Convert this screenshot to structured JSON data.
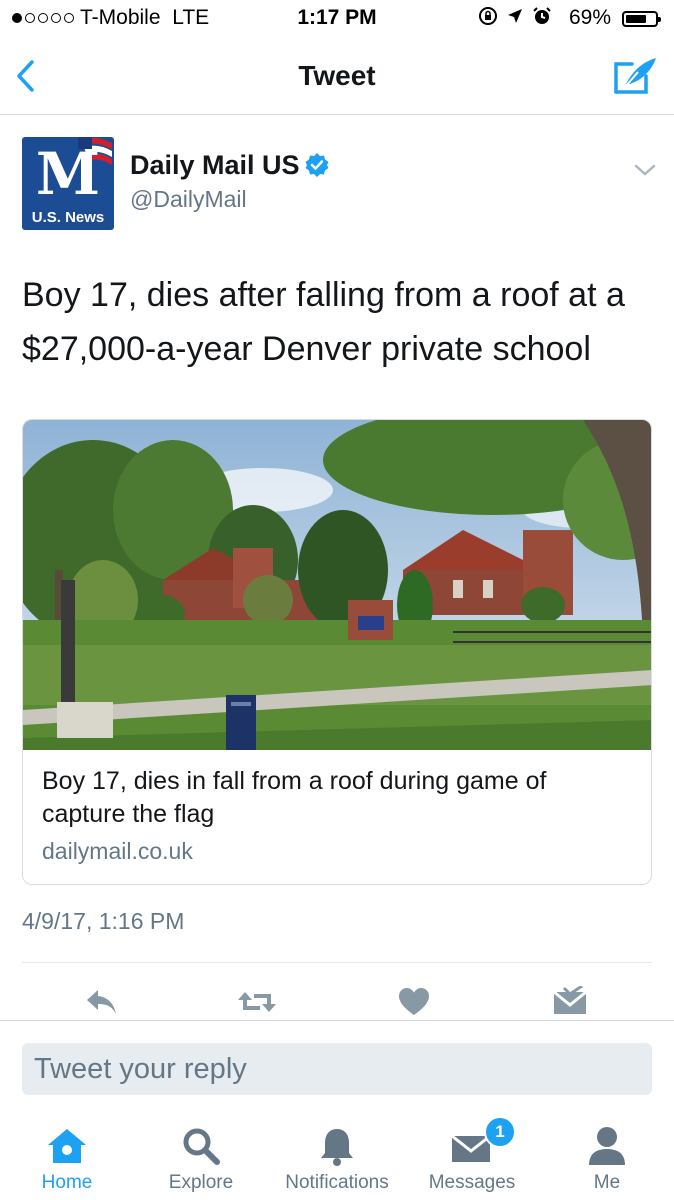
{
  "status_bar": {
    "signal_bars": 1,
    "signal_max": 5,
    "carrier": "T-Mobile",
    "network": "LTE",
    "time": "1:17 PM",
    "battery_percent": "69%",
    "battery_level": 0.69,
    "icons": [
      "rotation-lock-icon",
      "location-arrow-icon",
      "alarm-icon"
    ]
  },
  "nav": {
    "title": "Tweet",
    "back_icon": "chevron-left-icon",
    "compose_icon": "compose-tweet-icon"
  },
  "tweet": {
    "author": {
      "name": "Daily Mail US",
      "handle": "@DailyMail",
      "verified": true,
      "avatar_caption": "U.S. News",
      "avatar_letter": "M"
    },
    "text": "Boy 17, dies after falling from a roof at a $27,000-a-year Denver private school",
    "card": {
      "title": "Boy 17, dies in fall from a roof during game of capture the flag",
      "domain": "dailymail.co.uk"
    },
    "timestamp": "4/9/17, 1:16 PM"
  },
  "actions": [
    "reply-icon",
    "retweet-icon",
    "like-icon",
    "direct-message-icon"
  ],
  "reply_box": {
    "placeholder": "Tweet your reply"
  },
  "tabbar": {
    "tabs": [
      {
        "label": "Home",
        "icon": "home-icon",
        "active": true
      },
      {
        "label": "Explore",
        "icon": "search-icon",
        "active": false
      },
      {
        "label": "Notifications",
        "icon": "bell-icon",
        "active": false
      },
      {
        "label": "Messages",
        "icon": "envelope-icon",
        "active": false,
        "badge": "1"
      },
      {
        "label": "Me",
        "icon": "person-icon",
        "active": false
      }
    ]
  },
  "colors": {
    "accent": "#1da1f2",
    "text": "#14171a",
    "secondary": "#657786",
    "icon_gray": "#8899a6",
    "avatar_blue": "#1b4c94"
  }
}
